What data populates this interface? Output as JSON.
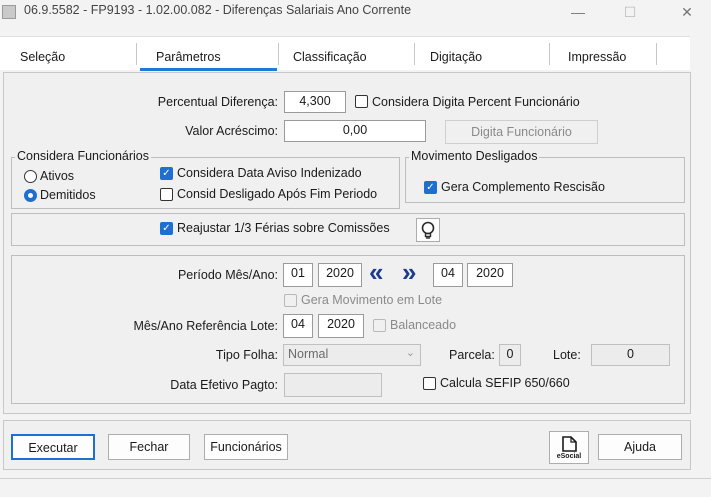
{
  "window": {
    "title": "06.9.5582 - FP9193 - 1.02.00.082 - Diferenças Salariais Ano Corrente",
    "minimize": "—",
    "maximize": "☐",
    "close": "✕"
  },
  "tabs": [
    {
      "label": "Seleção"
    },
    {
      "label": "Parâmetros"
    },
    {
      "label": "Classificação"
    },
    {
      "label": "Digitação"
    },
    {
      "label": "Impressão"
    }
  ],
  "active_tab": "Parâmetros",
  "accent_color": "#1e7ad6",
  "form": {
    "percentual_label": "Percentual Diferença:",
    "percentual_value": "4,300",
    "considera_digita_label": "Considera Digita Percent Funcionário",
    "considera_digita_checked": false,
    "valor_label": "Valor Acréscimo:",
    "valor_value": "0,00",
    "digita_funcionario_button": "Digita Funcionário"
  },
  "considera_funcionarios": {
    "title": "Considera Funcionários",
    "ativos_label": "Ativos",
    "demitidos_label": "Demitidos",
    "selected": "Demitidos",
    "data_aviso_label": "Considera Data Aviso Indenizado",
    "data_aviso_checked": true,
    "desligado_label": "Consid Desligado Após Fim Periodo",
    "desligado_checked": false
  },
  "movimento": {
    "title": "Movimento Desligados",
    "gera_label": "Gera Complemento Rescisão",
    "gera_checked": true
  },
  "reajustar": {
    "label": "Reajustar 1/3 Férias sobre Comissões",
    "checked": true,
    "icon": "lightbulb-icon"
  },
  "periodo": {
    "label": "Período Mês/Ano:",
    "mes_inicio": "01",
    "ano_inicio": "2020",
    "prev_icon": "«",
    "next_icon": "»",
    "mes_fim": "04",
    "ano_fim": "2020",
    "gera_movimento_lote_label": "Gera Movimento em Lote",
    "referencia_label": "Mês/Ano Referência Lote:",
    "ref_mes": "04",
    "ref_ano": "2020",
    "balanceado_label": "Balanceado",
    "tipo_folha_label": "Tipo Folha:",
    "tipo_folha_value": "Normal",
    "parcela_label": "Parcela:",
    "parcela_value": "0",
    "lote_label": "Lote:",
    "lote_value": "0",
    "data_efetivo_label": "Data Efetivo Pagto:",
    "data_efetivo_value": "",
    "calcula_sefip_label": "Calcula SEFIP 650/660",
    "calcula_sefip_checked": false
  },
  "buttons": {
    "executar": "Executar",
    "fechar": "Fechar",
    "funcionarios": "Funcionários",
    "esocial": "eSocial",
    "ajuda": "Ajuda"
  }
}
